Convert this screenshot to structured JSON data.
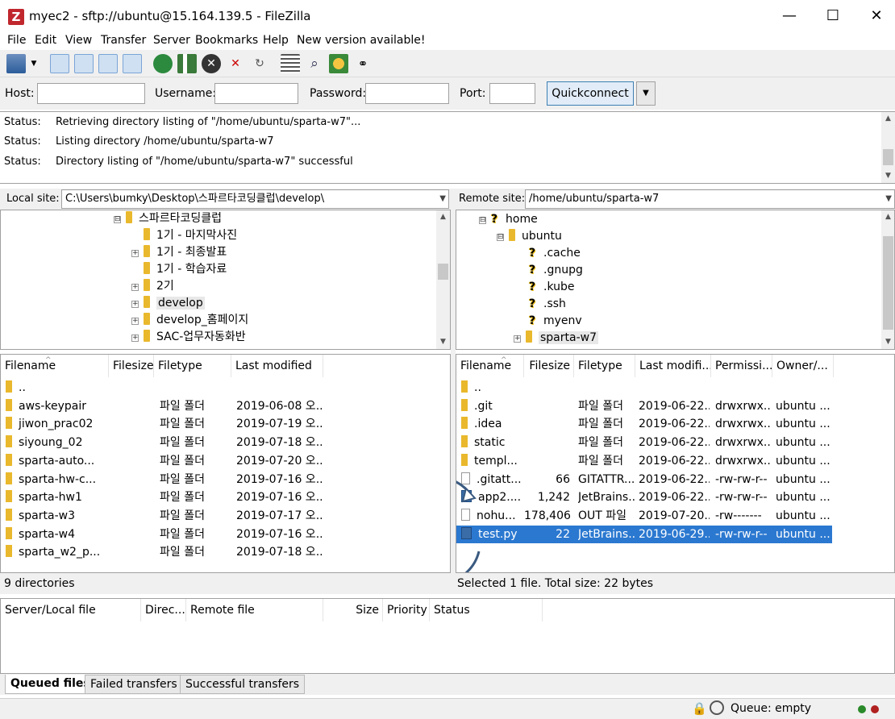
{
  "window": {
    "title": "myec2 - sftp://ubuntu@15.164.139.5 - FileZilla",
    "app_icon_letter": "Z",
    "minimize": "—",
    "maximize": "☐",
    "close": "✕"
  },
  "menu": [
    "File",
    "Edit",
    "View",
    "Transfer",
    "Server",
    "Bookmarks",
    "Help",
    "New version available!"
  ],
  "quickconnect": {
    "host_label": "Host:",
    "username_label": "Username:",
    "password_label": "Password:",
    "port_label": "Port:",
    "button_label": "Quickconnect",
    "dropdown": "▼"
  },
  "log": [
    {
      "key": "Status:",
      "text": "Retrieving directory listing of \"/home/ubuntu/sparta-w7\"..."
    },
    {
      "key": "Status:",
      "text": "Listing directory /home/ubuntu/sparta-w7"
    },
    {
      "key": "Status:",
      "text": "Directory listing of \"/home/ubuntu/sparta-w7\" successful"
    }
  ],
  "local": {
    "site_label": "Local site:",
    "site_path": "C:\\Users\\bumky\\Desktop\\스파르타코딩클럽\\develop\\",
    "tree": [
      {
        "label": "스파르타코딩클럽",
        "expander": "⊟"
      },
      {
        "label": "1기 - 마지막사진",
        "expander": ""
      },
      {
        "label": "1기 - 최종발표",
        "expander": "+"
      },
      {
        "label": "1기 - 학습자료",
        "expander": ""
      },
      {
        "label": "2기",
        "expander": "+"
      },
      {
        "label": "develop",
        "expander": "+"
      },
      {
        "label": "develop_홈페이지",
        "expander": "+"
      },
      {
        "label": "SAC-업무자동화반",
        "expander": "+"
      }
    ],
    "columns": [
      "Filename",
      "Filesize",
      "Filetype",
      "Last modified"
    ],
    "files": [
      {
        "name": "..",
        "size": "",
        "type": "",
        "modified": ""
      },
      {
        "name": "aws-keypair",
        "size": "",
        "type": "파일 폴더",
        "modified": "2019-06-08 오..."
      },
      {
        "name": "jiwon_prac02",
        "size": "",
        "type": "파일 폴더",
        "modified": "2019-07-19 오..."
      },
      {
        "name": "siyoung_02",
        "size": "",
        "type": "파일 폴더",
        "modified": "2019-07-18 오..."
      },
      {
        "name": "sparta-auto...",
        "size": "",
        "type": "파일 폴더",
        "modified": "2019-07-20 오..."
      },
      {
        "name": "sparta-hw-c...",
        "size": "",
        "type": "파일 폴더",
        "modified": "2019-07-16 오..."
      },
      {
        "name": "sparta-hw1",
        "size": "",
        "type": "파일 폴더",
        "modified": "2019-07-16 오..."
      },
      {
        "name": "sparta-w3",
        "size": "",
        "type": "파일 폴더",
        "modified": "2019-07-17 오..."
      },
      {
        "name": "sparta-w4",
        "size": "",
        "type": "파일 폴더",
        "modified": "2019-07-16 오..."
      },
      {
        "name": "sparta_w2_p...",
        "size": "",
        "type": "파일 폴더",
        "modified": "2019-07-18 오..."
      }
    ],
    "status": "9 directories"
  },
  "remote": {
    "site_label": "Remote site:",
    "site_path": "/home/ubuntu/sparta-w7",
    "tree": [
      {
        "label": "home",
        "expander": "⊟"
      },
      {
        "label": "ubuntu",
        "expander": "⊟"
      },
      {
        "label": ".cache",
        "expander": ""
      },
      {
        "label": ".gnupg",
        "expander": ""
      },
      {
        "label": ".kube",
        "expander": ""
      },
      {
        "label": ".ssh",
        "expander": ""
      },
      {
        "label": "myenv",
        "expander": ""
      },
      {
        "label": "sparta-w7",
        "expander": "+"
      }
    ],
    "columns": [
      "Filename",
      "Filesize",
      "Filetype",
      "Last modifi...",
      "Permissi...",
      "Owner/..."
    ],
    "files": [
      {
        "name": "..",
        "size": "",
        "type": "",
        "modified": "",
        "perm": "",
        "owner": "",
        "icon": "dir"
      },
      {
        "name": ".git",
        "size": "",
        "type": "파일 폴더",
        "modified": "2019-06-22...",
        "perm": "drwxrwx...",
        "owner": "ubuntu ...",
        "icon": "dir"
      },
      {
        "name": ".idea",
        "size": "",
        "type": "파일 폴더",
        "modified": "2019-06-22...",
        "perm": "drwxrwx...",
        "owner": "ubuntu ...",
        "icon": "dir"
      },
      {
        "name": "static",
        "size": "",
        "type": "파일 폴더",
        "modified": "2019-06-22...",
        "perm": "drwxrwx...",
        "owner": "ubuntu ...",
        "icon": "dir"
      },
      {
        "name": "templ...",
        "size": "",
        "type": "파일 폴더",
        "modified": "2019-06-22...",
        "perm": "drwxrwx...",
        "owner": "ubuntu ...",
        "icon": "dir"
      },
      {
        "name": ".gitatt...",
        "size": "66",
        "type": "GITATTR...",
        "modified": "2019-06-22...",
        "perm": "-rw-rw-r--",
        "owner": "ubuntu ...",
        "icon": "file"
      },
      {
        "name": "app2....",
        "size": "1,242",
        "type": "JetBrains...",
        "modified": "2019-06-22...",
        "perm": "-rw-rw-r--",
        "owner": "ubuntu ...",
        "icon": "py"
      },
      {
        "name": "nohu...",
        "size": "178,406",
        "type": "OUT 파일",
        "modified": "2019-07-20...",
        "perm": "-rw-------",
        "owner": "ubuntu ...",
        "icon": "file"
      },
      {
        "name": "test.py",
        "size": "22",
        "type": "JetBrains...",
        "modified": "2019-06-29...",
        "perm": "-rw-rw-r--",
        "owner": "ubuntu ...",
        "icon": "py",
        "selected": true
      }
    ],
    "status": "Selected 1 file. Total size: 22 bytes"
  },
  "queue": {
    "columns": [
      "Server/Local file",
      "Direc...",
      "Remote file",
      "Size",
      "Priority",
      "Status"
    ],
    "tabs": [
      "Queued files",
      "Failed transfers",
      "Successful transfers"
    ]
  },
  "statusbar": {
    "queue": "Queue: empty"
  },
  "colors": {
    "selection": "#2b78d0",
    "folder": "#e9b82c",
    "accent": "#3c7fb1"
  }
}
